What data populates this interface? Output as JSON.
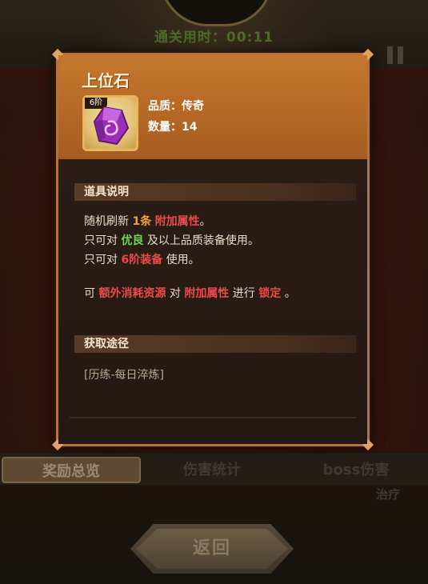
{
  "hud": {
    "timer_text": "通关用时：00:11"
  },
  "item": {
    "name": "上位石",
    "tier_badge": "6阶",
    "quality_line": "品质：传奇",
    "count_line": "数量：14",
    "icon": "purple-crystal-icon"
  },
  "sections": {
    "description_title": "道具说明",
    "source_title": "获取途径"
  },
  "description": {
    "line1": [
      "随机刷新 ",
      "1条",
      " ",
      "附加属性",
      "。"
    ],
    "line2": [
      "只可对 ",
      "优良",
      " 及以上品质装备使用。"
    ],
    "line3": [
      "只可对 ",
      "6阶装备",
      " 使用。"
    ],
    "line4": [
      "可 ",
      "额外消耗资源",
      " 对 ",
      "附加属性",
      " 进行 ",
      "锁定",
      " 。"
    ]
  },
  "source": {
    "text": "[历练-每日淬炼]"
  },
  "tabs": {
    "items": [
      {
        "label": "奖励总览",
        "active": true
      },
      {
        "label": "伤害统计",
        "active": false
      },
      {
        "label": "boss伤害",
        "active": false
      }
    ],
    "side_label": "治疗"
  },
  "buttons": {
    "back_label": "返回"
  },
  "colors": {
    "header": "#c4782e",
    "accent_orange": "#f2a23c",
    "accent_red": "#ea4c4c",
    "accent_green": "#7bd05a",
    "crystal": "#b03ec8"
  }
}
